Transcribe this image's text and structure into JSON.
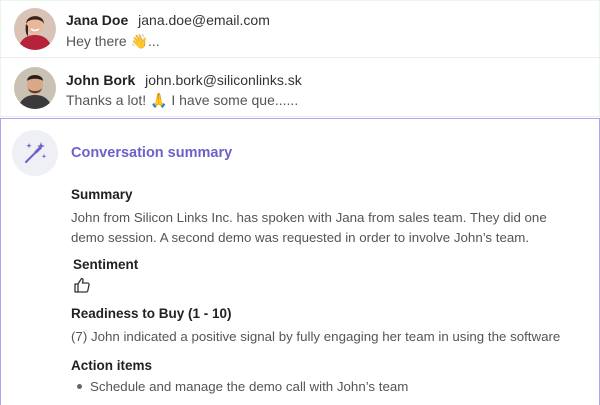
{
  "messages": [
    {
      "name": "Jana Doe",
      "email": "jana.doe@email.com",
      "preview": "Hey there 👋..."
    },
    {
      "name": "John Bork",
      "email": "john.bork@siliconlinks.sk",
      "preview": "Thanks a lot! 🙏 I have some que......"
    }
  ],
  "summary_panel": {
    "icon": "magic-wand-icon",
    "title": "Conversation summary",
    "summary_heading": "Summary",
    "summary_text": "John from Silicon Links Inc. has spoken with Jana from sales team. They did one demo session. A second demo was requested in order to involve John’s team.",
    "sentiment_heading": "Sentiment",
    "sentiment_icon": "thumbs-up-icon",
    "readiness_heading": "Readiness to Buy (1 - 10)",
    "readiness_text": "(7) John indicated a positive signal by fully engaging her team in using the software",
    "action_heading": "Action items",
    "action_items": [
      "Schedule and manage the demo call with John’s team"
    ]
  },
  "colors": {
    "accent": "#6b62c9",
    "panel_border": "#a9a7e8"
  }
}
